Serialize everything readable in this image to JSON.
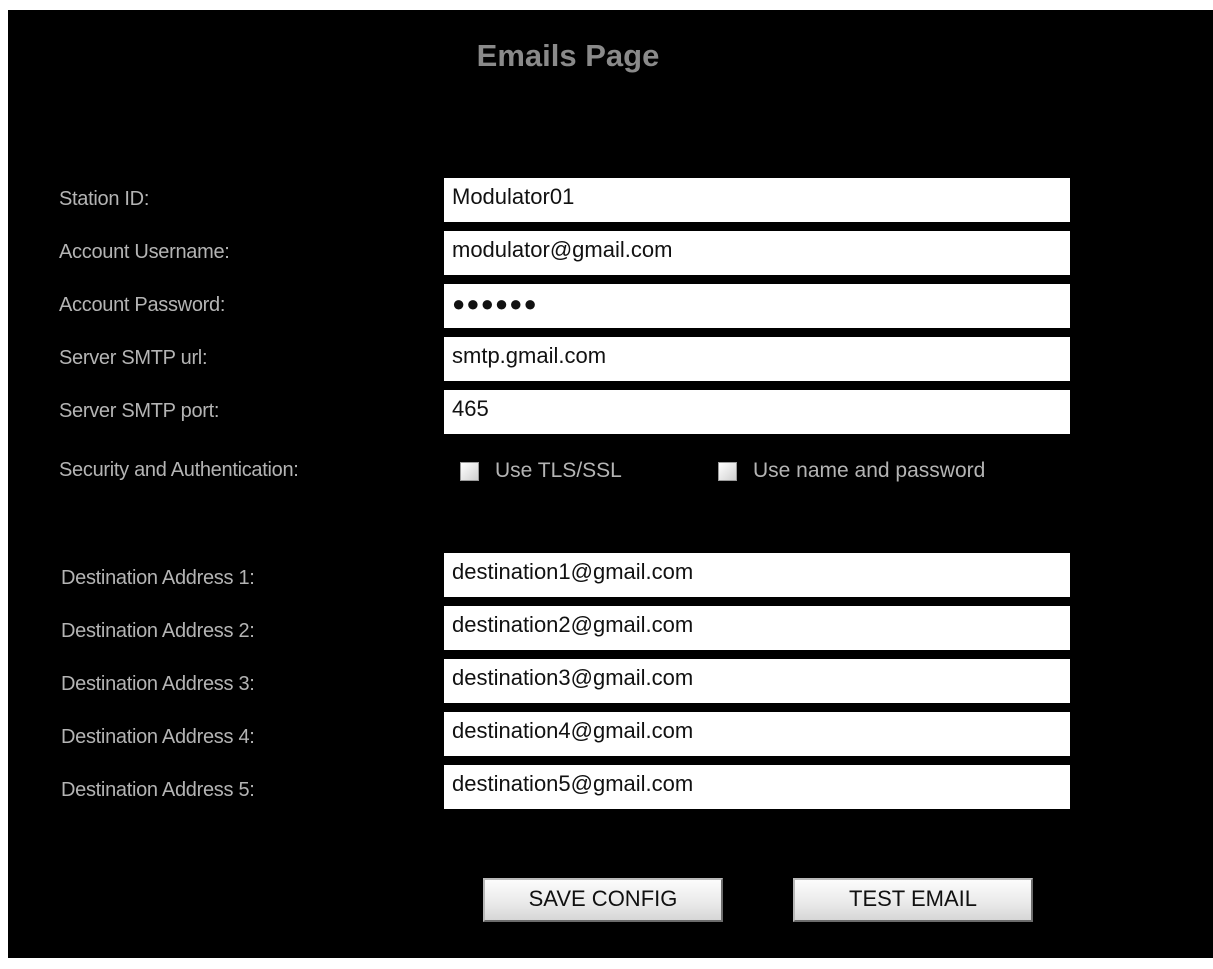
{
  "page": {
    "title": "Emails Page"
  },
  "account": {
    "station_id": {
      "label": "Station ID:",
      "value": "Modulator01"
    },
    "username": {
      "label": "Account Username:",
      "value": "modulator@gmail.com"
    },
    "password": {
      "label": "Account Password:",
      "value": "●●●●●●"
    },
    "smtp_url": {
      "label": "Server SMTP url:",
      "value": "smtp.gmail.com"
    },
    "smtp_port": {
      "label": "Server SMTP port:",
      "value": "465"
    }
  },
  "security": {
    "label": "Security and Authentication:",
    "use_tls": {
      "label": "Use TLS/SSL",
      "checked": false
    },
    "use_auth": {
      "label": "Use name and password",
      "checked": false
    }
  },
  "destinations": [
    {
      "label": "Destination Address 1:",
      "value": "destination1@gmail.com"
    },
    {
      "label": "Destination Address 2:",
      "value": "destination2@gmail.com"
    },
    {
      "label": "Destination Address 3:",
      "value": "destination3@gmail.com"
    },
    {
      "label": "Destination Address 4:",
      "value": "destination4@gmail.com"
    },
    {
      "label": "Destination Address 5:",
      "value": "destination5@gmail.com"
    }
  ],
  "buttons": {
    "save": "SAVE CONFIG",
    "test": "TEST EMAIL"
  },
  "colors": {
    "panel_background": "#000000",
    "title": "#8a8a8a",
    "label": "#b4b4b4",
    "field_background": "#ffffff"
  }
}
